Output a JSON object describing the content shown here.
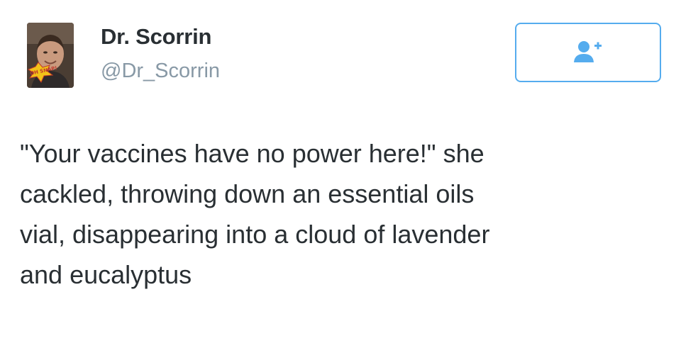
{
  "tweet": {
    "author": {
      "display_name": "Dr. Scorrin",
      "screen_name": "@Dr_Scorrin",
      "avatar_badge_text": "OH SNAP!"
    },
    "follow_button": {
      "icon": "add-user-icon",
      "accent_color": "#55acee"
    },
    "text_lines": [
      "\"Your vaccines have no power here!\" she",
      "cackled, throwing down an essential oils",
      "vial, disappearing into a cloud of lavender",
      "and eucalyptus"
    ]
  },
  "colors": {
    "text": "#292f33",
    "muted": "#8899a6",
    "accent": "#55acee",
    "background": "#ffffff"
  }
}
